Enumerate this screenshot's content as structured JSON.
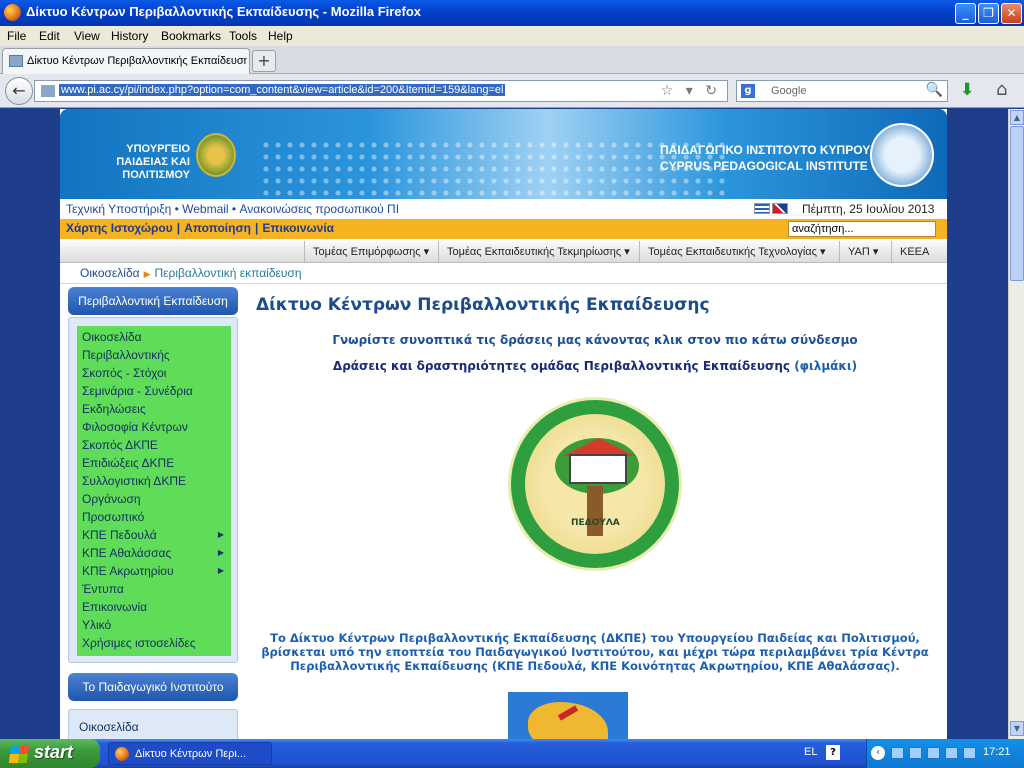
{
  "window": {
    "title": "Δίκτυο Κέντρων Περιβαλλοντικής Εκπαίδευσης - Mozilla Firefox",
    "controls": [
      "_",
      "❐",
      "✕"
    ]
  },
  "menubar": [
    "File",
    "Edit",
    "View",
    "History",
    "Bookmarks",
    "Tools",
    "Help"
  ],
  "tab": {
    "label": "Δίκτυο Κέντρων Περιβαλλοντικής Εκπαίδευσης",
    "new_tab_label": "+"
  },
  "nav": {
    "back_label": "←",
    "url": "www.pi.ac.cy/pi/index.php?option=com_content&view=article&id=200&Itemid=159&lang=el",
    "url_icons": "☆ ▾ ↻",
    "search_engine_label": "Google",
    "search_engine_icon": "g-icon",
    "search_icon": "🔍",
    "download_icon": "⬇",
    "home_icon": "⌂"
  },
  "site": {
    "ministry": "ΥΠΟΥΡΓΕΙΟ ΠΑΙΔΕΙΑΣ ΚΑΙ ΠΟΛΙΤΙΣΜΟΥ",
    "institute_gr": "ΠΑΙΔΑΓΩΓΙΚΟ ΙΝΣΤΙΤΟΥΤΟ ΚΥΠΡΟΥ",
    "institute_en": "CYPRUS PEDAGOGICAL INSTITUTE",
    "top_links": "Τεχνική Υποστήριξη • Webmail • Ανακοινώσεις προσωπικού ΠΙ",
    "date": "Πέμπτη, 25 Ιουλίου 2013",
    "orange_links": [
      "Χάρτης Ιστοχώρου",
      "Αποποίηση",
      "Επικοινωνία"
    ],
    "orange_sep": "|",
    "site_search_value": "αναζήτηση...",
    "menu": [
      "Τομέας Επιμόρφωσης ▾",
      "Τομέας Εκπαιδευτικής Τεκμηρίωσης ▾",
      "Τομέας Εκπαιδευτικής Τεχνολογίας ▾",
      "ΥΑΠ ▾",
      "ΚΕΕΑ"
    ],
    "breadcrumb": {
      "home": "Οικοσελίδα",
      "arrow": "▶",
      "current": "Περιβαλλοντική εκπαίδευση"
    },
    "sidebar": {
      "heading": "Περιβαλλοντική Εκπαίδευση",
      "items": [
        {
          "label": "Οικοσελίδα",
          "sub": ""
        },
        {
          "label": "Περιβαλλοντικής",
          "sub": ""
        },
        {
          "label": "Σκοπός - Στόχοι",
          "sub": ""
        },
        {
          "label": "Σεμινάρια - Συνέδρια",
          "sub": ""
        },
        {
          "label": "Εκδηλώσεις",
          "sub": ""
        },
        {
          "label": "Φιλοσοφία Κέντρων",
          "sub": ""
        },
        {
          "label": "Σκοπός ΔΚΠΕ",
          "sub": ""
        },
        {
          "label": "Επιδιώξεις ΔΚΠΕ",
          "sub": ""
        },
        {
          "label": "Συλλογιστική ΔΚΠΕ",
          "sub": ""
        },
        {
          "label": "Οργάνωση",
          "sub": ""
        },
        {
          "label": "Προσωπικό",
          "sub": ""
        },
        {
          "label": "ΚΠΕ Πεδουλά",
          "sub": "▶"
        },
        {
          "label": "ΚΠΕ Αθαλάσσας",
          "sub": "▶"
        },
        {
          "label": "ΚΠΕ Ακρωτηρίου",
          "sub": "▶"
        },
        {
          "label": "Έντυπα",
          "sub": ""
        },
        {
          "label": "Επικοινωνία",
          "sub": ""
        },
        {
          "label": "Υλικό",
          "sub": ""
        },
        {
          "label": "Χρήσιμες ιστοσελίδες",
          "sub": ""
        }
      ],
      "heading2": "Το Παιδαγωγικό Ινστιτούτο",
      "items2": [
        "Οικοσελίδα"
      ]
    },
    "content": {
      "title": "Δίκτυο Κέντρων Περιβαλλοντικής Εκπαίδευσης",
      "intro1": "Γνωρίστε συνοπτικά τις δράσεις μας κάνοντας κλικ στον πιο κάτω σύνδεσμο",
      "intro2": "Δράσεις και δραστηριότητες ομάδας Περιβαλλοντικής Εκπαίδευσης",
      "intro2_paren": "(φιλμάκι)",
      "seal_text": "ΠΕΔΟΥΛΑ",
      "paragraph": "Το Δίκτυο Κέντρων Περιβαλλοντικής Εκπαίδευσης (ΔΚΠΕ) του Υπουργείου Παιδείας και Πολιτισμού, βρίσκεται υπό την εποπτεία του Παιδαγωγικού Ινστιτούτου, και μέχρι τώρα περιλαμβάνει τρία Κέντρα Περιβαλλοντικής Εκπαίδευσης (ΚΠΕ Πεδουλά, ΚΠΕ Κοινότητας Ακρωτηρίου, ΚΠΕ Αθαλάσσας)."
    }
  },
  "taskbar": {
    "start_label": "start",
    "task_label": "Δίκτυο Κέντρων Περι...",
    "lang": "EL",
    "help": "?",
    "tray_chevron": "‹",
    "clock": "17:21"
  }
}
